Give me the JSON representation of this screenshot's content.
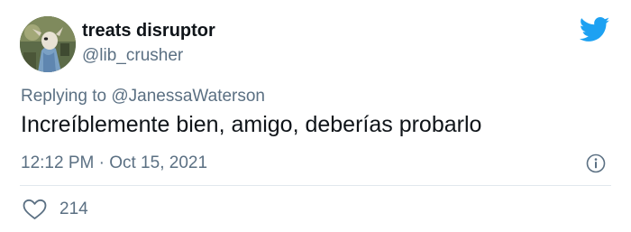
{
  "user": {
    "display_name": "treats disruptor",
    "handle": "@lib_crusher"
  },
  "reply": {
    "prefix": "Replying to",
    "mention": "@JanessaWaterson"
  },
  "tweet": {
    "text": "Increíblemente bien, amigo, deberías probarlo",
    "time": "12:12 PM",
    "separator": "·",
    "date": "Oct 15, 2021"
  },
  "actions": {
    "like_count": "214"
  },
  "icons": {
    "brand": "twitter-bird-icon",
    "info": "info-icon",
    "like": "heart-icon"
  },
  "colors": {
    "brand_blue": "#1da1f2",
    "text_primary": "#0f1419",
    "text_secondary": "#5b7083",
    "divider": "#e1e8ed"
  }
}
